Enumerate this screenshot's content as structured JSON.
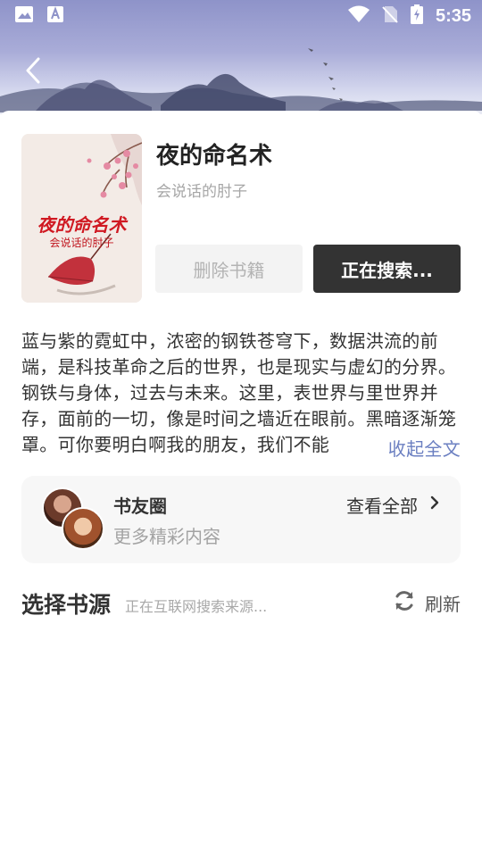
{
  "status_bar": {
    "time": "5:35",
    "left_icons": [
      "image-icon",
      "font-icon"
    ],
    "right_icons": [
      "wifi-icon",
      "no-sim-icon",
      "battery-charging-icon"
    ]
  },
  "header": {
    "back_icon": "chevron-left-icon"
  },
  "book": {
    "title": "夜的命名术",
    "author": "会说话的肘子",
    "cover_title": "夜的命名术",
    "cover_author": "会说话的肘子",
    "delete_label": "删除书籍",
    "status_button_label": "正在搜索..."
  },
  "intro": {
    "text": "蓝与紫的霓虹中，浓密的钢铁苍穹下，数据洪流的前端，是科技革命之后的世界，也是现实与虚幻的分界。钢铁与身体，过去与未来。这里，表世界与里世界并存，面前的一切，像是时间之墙近在眼前。黑暗逐渐笼罩。可你要明白啊我的朋友，我们不能",
    "collapse_label": "收起全文"
  },
  "circle": {
    "title": "书友圈",
    "subtitle": "更多精彩内容",
    "view_all_label": "查看全部"
  },
  "source": {
    "title": "选择书源",
    "status": "正在互联网搜索来源...",
    "refresh_label": "刷新"
  },
  "colors": {
    "accent_link": "#6b7fc1",
    "dark_button": "#333333",
    "cover_title_red": "#d01922"
  }
}
